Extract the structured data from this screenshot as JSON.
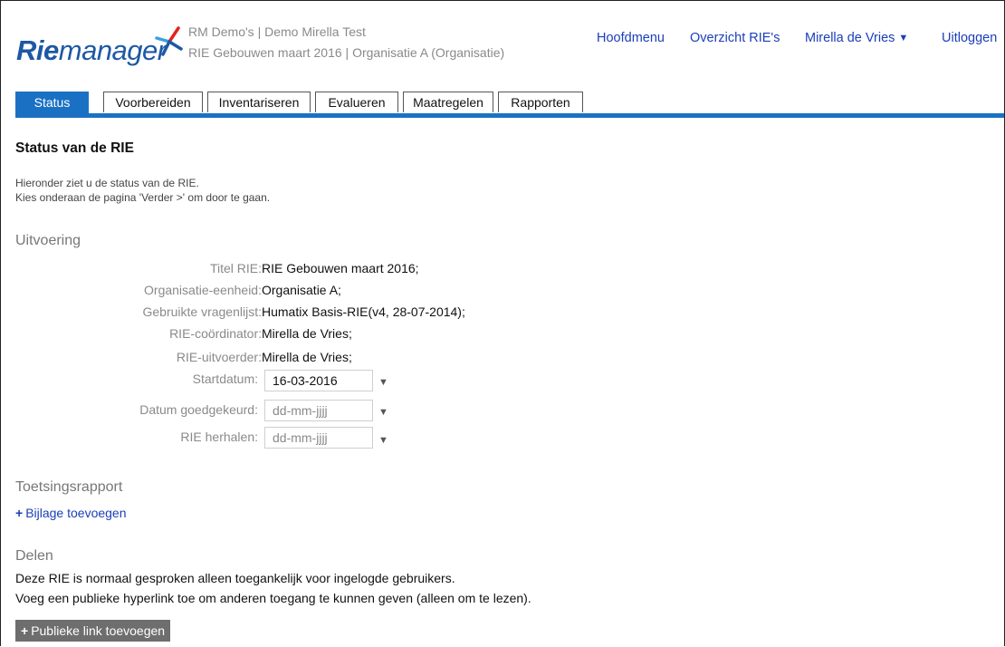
{
  "app": {
    "logo_rie": "Rie",
    "logo_manager": "manager",
    "context_line1": "RM Demo's  |  Demo Mirella Test",
    "context_line2": "RIE Gebouwen maart 2016  |  Organisatie A  (Organisatie)"
  },
  "topnav": {
    "hoofdmenu": "Hoofdmenu",
    "overzicht": "Overzicht RIE's",
    "user": "Mirella de Vries",
    "logout": "Uitloggen"
  },
  "tabs": [
    {
      "label": "Status",
      "active": true
    },
    {
      "label": "Voorbereiden",
      "active": false
    },
    {
      "label": "Inventariseren",
      "active": false
    },
    {
      "label": "Evalueren",
      "active": false
    },
    {
      "label": "Maatregelen",
      "active": false
    },
    {
      "label": "Rapporten",
      "active": false
    }
  ],
  "page": {
    "title": "Status van de RIE",
    "intro1": "Hieronder ziet u de status van de RIE.",
    "intro2": "Kies onderaan de pagina 'Verder >' om door te gaan."
  },
  "uitvoering": {
    "heading": "Uitvoering",
    "titel_label": "Titel RIE:",
    "titel_value": "RIE Gebouwen maart 2016;",
    "org_label": "Organisatie-eenheid:",
    "org_value": "Organisatie A;",
    "vragenlijst_label": "Gebruikte vragenlijst:",
    "vragenlijst_value": "Humatix Basis-RIE(v4, 28-07-2014);",
    "coordinator_label": "RIE-coördinator:",
    "coordinator_value": "Mirella de Vries;",
    "uitvoerder_label": "RIE-uitvoerder:",
    "uitvoerder_value": "Mirella de Vries;",
    "startdatum_label": "Startdatum:",
    "startdatum_value": "16-03-2016",
    "goedgekeurd_label": "Datum goedgekeurd:",
    "goedgekeurd_placeholder": "dd-mm-jjjj",
    "herhalen_label": "RIE herhalen:",
    "herhalen_placeholder": "dd-mm-jjjj"
  },
  "toetsing": {
    "heading": "Toetsingsrapport",
    "add_label": "Bijlage toevoegen"
  },
  "delen": {
    "heading": "Delen",
    "line1": "Deze RIE is normaal gesproken alleen toegankelijk voor ingelogde gebruikers.",
    "line2": "Voeg een publieke hyperlink toe om anderen toegang te kunnen geven (alleen om te lezen).",
    "button_label": "Publieke link toevoegen"
  },
  "colors": {
    "accent": "#1a71c3",
    "link": "#1a3fb8",
    "logo": "#1d58a4",
    "logo_mark_red": "#e2231a",
    "button_bg": "#6e6e6e"
  },
  "icons": [
    "riemanager-logo-mark",
    "chevron-down-icon",
    "plus-icon"
  ]
}
